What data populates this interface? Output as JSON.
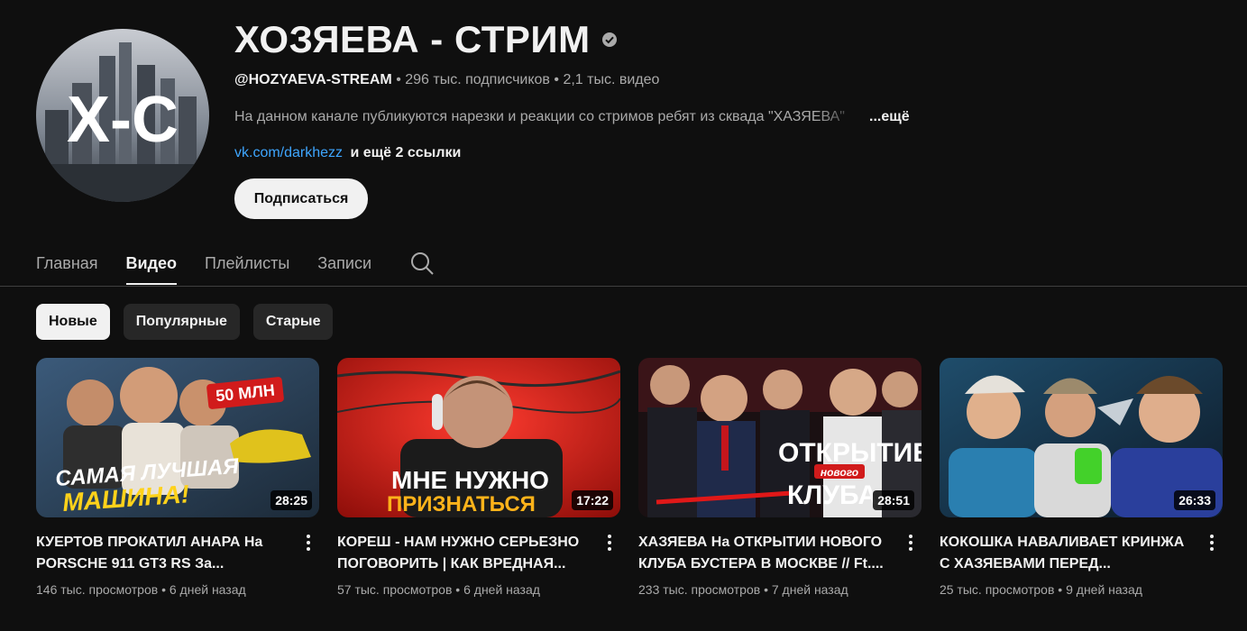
{
  "channel": {
    "name": "ХОЗЯЕВА - СТРИМ",
    "handle": "@HOZYAEVA-STREAM",
    "subscribers": "296 тыс. подписчиков",
    "video_count": "2,1 тыс. видео",
    "separator": "•",
    "description": "На данном канале публикуются нарезки и реакции со стримов ребят из сквада \"ХАЗЯЕВА\"",
    "description_more": "...ещё",
    "link": "vk.com/darkhezz",
    "more_links": "и ещё 2 ссылки",
    "subscribe_label": "Подписаться",
    "avatar_text": "X-C"
  },
  "tabs": [
    {
      "label": "Главная",
      "active": false
    },
    {
      "label": "Видео",
      "active": true
    },
    {
      "label": "Плейлисты",
      "active": false
    },
    {
      "label": "Записи",
      "active": false
    }
  ],
  "chips": [
    {
      "label": "Новые",
      "active": true
    },
    {
      "label": "Популярные",
      "active": false
    },
    {
      "label": "Старые",
      "active": false
    }
  ],
  "videos": [
    {
      "title": "КУЕРТОВ ПРОКАТИЛ АНАРА На PORSCHE 911 GT3 RS За...",
      "views": "146 тыс. просмотров",
      "age": "6 дней назад",
      "duration": "28:25",
      "thumb_text_top": "САМАЯ ЛУЧШАЯ",
      "thumb_text_bottom": "МАШИНА!",
      "thumb_badge": "50 МЛН"
    },
    {
      "title": "КОРЕШ - НАМ НУЖНО СЕРЬЕЗНО ПОГОВОРИТЬ | КАК ВРЕДНАЯ...",
      "views": "57 тыс. просмотров",
      "age": "6 дней назад",
      "duration": "17:22",
      "thumb_text_top": "МНЕ НУЖНО",
      "thumb_text_bottom": "ПРИЗНАТЬСЯ"
    },
    {
      "title": "ХАЗЯЕВА На ОТКРЫТИИ НОВОГО КЛУБА БУСТЕРА В МОСКВЕ // Ft....",
      "views": "233 тыс. просмотров",
      "age": "7 дней назад",
      "duration": "28:51",
      "thumb_text_top": "ОТКРЫТИЕ",
      "thumb_text_mid": "нового",
      "thumb_text_bottom": "КЛУБА"
    },
    {
      "title": "КОКОШКА НАВАЛИВАЕТ КРИНЖА С ХАЗЯЕВАМИ ПЕРЕД...",
      "views": "25 тыс. просмотров",
      "age": "9 дней назад",
      "duration": "26:33"
    }
  ],
  "colors": {
    "background": "#0f0f0f",
    "text_primary": "#f1f1f1",
    "text_secondary": "#aaaaaa",
    "link": "#3ea6ff",
    "chip": "#272727"
  }
}
